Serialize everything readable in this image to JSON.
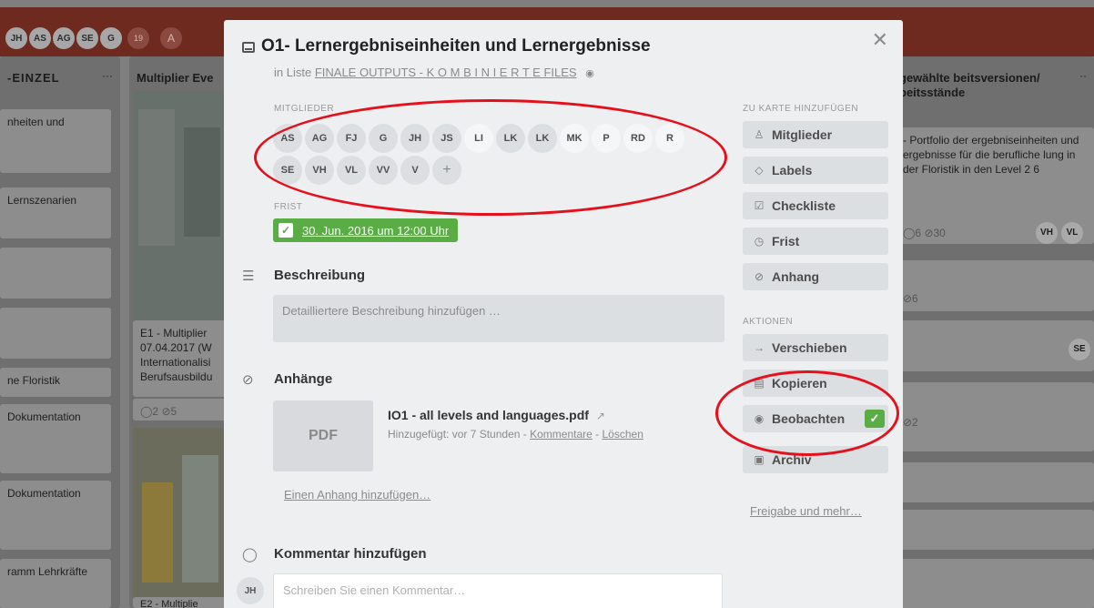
{
  "board": {
    "header_avatars": [
      "JH",
      "AS",
      "AG",
      "SE",
      "G"
    ],
    "member_count": "19",
    "add_member_glyph": "A",
    "lists": [
      {
        "title": "-EINZEL",
        "more": "···",
        "cards": [
          "nheiten und",
          "Lernszenarien",
          "",
          "",
          "ne Floristik",
          "Dokumentation",
          "Dokumentation",
          "ramm Lehrkräfte"
        ]
      },
      {
        "title": "Multiplier Eve",
        "card_text": "E1 - Multiplier 07.04.2017 (W Internationalisi Berufsausbildu",
        "badges": "◯2 ⊘5",
        "bottom_text": "E2 - Multiplie"
      },
      {
        "title": "gewählte beitsversionen/ beitsstände",
        "more": "··",
        "card_text": "- Portfolio der ergebniseinheiten und ergebnisse für die berufliche lung in der Floristik in den Level 2 6",
        "badges": "◯6  ⊘30",
        "card_avatars": [
          "VH",
          "VL"
        ],
        "card2_badge": "⊘6",
        "card3_avatar": "SE",
        "card4_badge": "⊘2"
      }
    ]
  },
  "card": {
    "close_icon": "✕",
    "title": "O1- Lernergebniseinheiten und Lernergebnisse",
    "list_prefix": "in Liste",
    "list_name": "FINALE OUTPUTS - K O M B I N I E R T E FILES",
    "watch_icon": "◉",
    "members_label": "MITGLIEDER",
    "members": [
      "AS",
      "AG",
      "FJ",
      "G",
      "JH",
      "JS",
      "LI",
      "LK",
      "LK",
      "MK",
      "P",
      "RD",
      "R",
      "SE",
      "VH",
      "VL",
      "VV",
      "V"
    ],
    "add_member": "+",
    "due_label": "FRIST",
    "due_check": "✓",
    "due_date": "30. Jun. 2016 um 12:00 Uhr",
    "description_heading": "Beschreibung",
    "description_placeholder": "Detailliertere Beschreibung hinzufügen …",
    "attachments_heading": "Anhänge",
    "attachment": {
      "thumb": "PDF",
      "name": "IO1 - all levels and languages.pdf",
      "open_icon": "↗",
      "added": "Hinzugefügt: vor 7 Stunden -",
      "comments_link": "Kommentare",
      "separator": "-",
      "delete_link": "Löschen"
    },
    "add_attachment": "Einen Anhang hinzufügen…",
    "comment_heading": "Kommentar hinzufügen",
    "comment_avatar": "JH",
    "comment_placeholder": "Schreiben Sie einen Kommentar…"
  },
  "sidebar": {
    "add_label": "ZU KARTE HINZUFÜGEN",
    "add_buttons": [
      {
        "icon": "♙",
        "label": "Mitglieder"
      },
      {
        "icon": "◇",
        "label": "Labels"
      },
      {
        "icon": "☑",
        "label": "Checkliste"
      },
      {
        "icon": "◷",
        "label": "Frist"
      },
      {
        "icon": "⊘",
        "label": "Anhang"
      }
    ],
    "actions_label": "AKTIONEN",
    "action_buttons": [
      {
        "icon": "→",
        "label": "Verschieben"
      },
      {
        "icon": "▤",
        "label": "Kopieren"
      },
      {
        "icon": "◉",
        "label": "Beobachten",
        "checked": "✓"
      },
      {
        "icon": "▣",
        "label": "Archiv"
      }
    ],
    "share_link": "Freigabe und mehr…"
  },
  "colors": {
    "due_green": "#5aac44",
    "annotation_red": "#e5101c",
    "header_brown": "#6e2a1f"
  }
}
